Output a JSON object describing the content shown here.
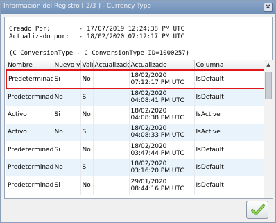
{
  "window": {
    "title": "Información del Registro [ 2/3 ] - Currency Type",
    "close_glyph": "✕"
  },
  "info": {
    "created_label": "Creado Por:",
    "created_sep": "-",
    "created_value": "17/07/2019 12:24:38 PM UTC",
    "updated_label": "Actualizado por:",
    "updated_sep": "-",
    "updated_value": "18/02/2020 07:12:17 PM UTC",
    "query": "(C_ConversionType - C_ConversionType_ID=1000257)"
  },
  "table": {
    "columns": [
      "Nombre",
      "Nuevo v",
      "Valo",
      "Actualizado",
      "Actualizado",
      "Columna"
    ],
    "rows": [
      [
        "Predeterminado",
        "Si",
        "No",
        "",
        "18/02/2020 07:12:17 PM UTC",
        "IsDefault"
      ],
      [
        "Predeterminado",
        "No",
        "Si",
        "",
        "18/02/2020 04:08:41 PM UTC",
        "IsDefault"
      ],
      [
        "Activo",
        "Si",
        "No",
        "",
        "18/02/2020 04:08:38 PM UTC",
        "IsActive"
      ],
      [
        "Activo",
        "No",
        "Si",
        "",
        "18/02/2020 04:08:33 PM UTC",
        "IsActive"
      ],
      [
        "Predeterminado",
        "Si",
        "No",
        "",
        "18/02/2020 03:47:44 PM UTC",
        "IsDefault"
      ],
      [
        "Predeterminado",
        "No",
        "Si",
        "",
        "18/02/2020 03:16:20 PM UTC",
        "IsDefault"
      ],
      [
        "Predeterminado",
        "Si",
        "No",
        "",
        "29/01/2020 08:44:16 PM UTC",
        "IsDefault"
      ]
    ],
    "selected_row": 0
  },
  "buttons": {
    "ok_icon": "checkmark-icon"
  },
  "colors": {
    "selection_outline": "#e0161b",
    "alt_row": "#e8f3fb",
    "ok_check": "#5fa832"
  }
}
